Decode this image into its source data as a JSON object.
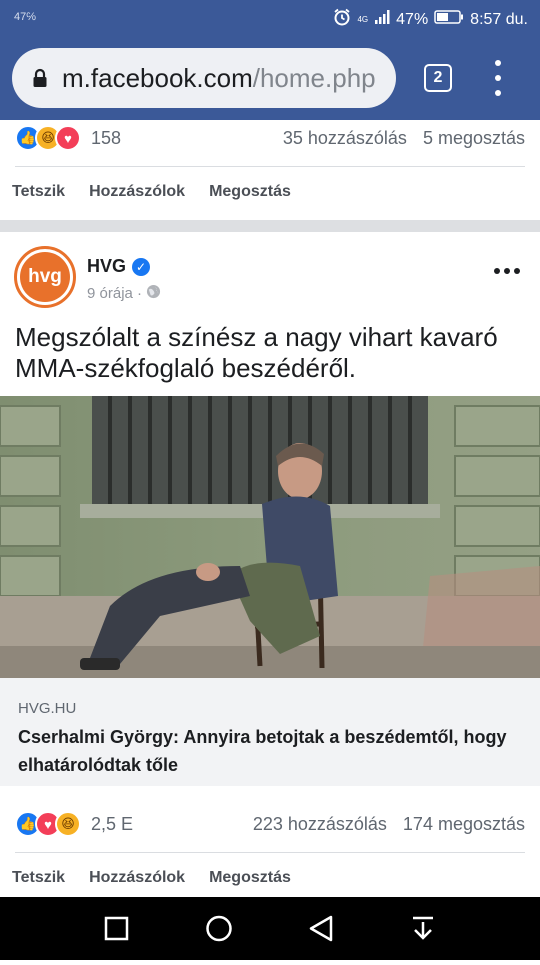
{
  "status_bar": {
    "left_text": "47℅",
    "network": "4G",
    "battery": "47%",
    "time": "8:57 du."
  },
  "browser": {
    "url_host": "m.facebook.com",
    "url_path": "/home.php",
    "tab_count": "2"
  },
  "prev_post": {
    "reaction_count": "158",
    "comments": "35 hozzászólás",
    "shares": "5 megosztás",
    "actions": {
      "like": "Tetszik",
      "comment": "Hozzászólok",
      "share": "Megosztás"
    }
  },
  "post": {
    "avatar_text": "hvg",
    "page_name": "HVG",
    "time": "9 órája ·",
    "text": "Megszólalt a színész a nagy vihart kavaró MMA-székfoglaló beszédéről.",
    "link_source": "HVG.HU",
    "link_title": "Cserhalmi György: Annyira betojtak a beszédemtől, hogy elhatárolódtak tőle",
    "reaction_count": "2,5 E",
    "comments": "223 hozzászólás",
    "shares": "174 megosztás",
    "actions": {
      "like": "Tetszik",
      "comment": "Hozzászólok",
      "share": "Megosztás"
    }
  },
  "colors": {
    "facebook_blue": "#3b5998",
    "hvg_orange": "#e8712b",
    "like_blue": "#1877f2",
    "love_red": "#f33e58",
    "haha_yellow": "#f7b125"
  }
}
